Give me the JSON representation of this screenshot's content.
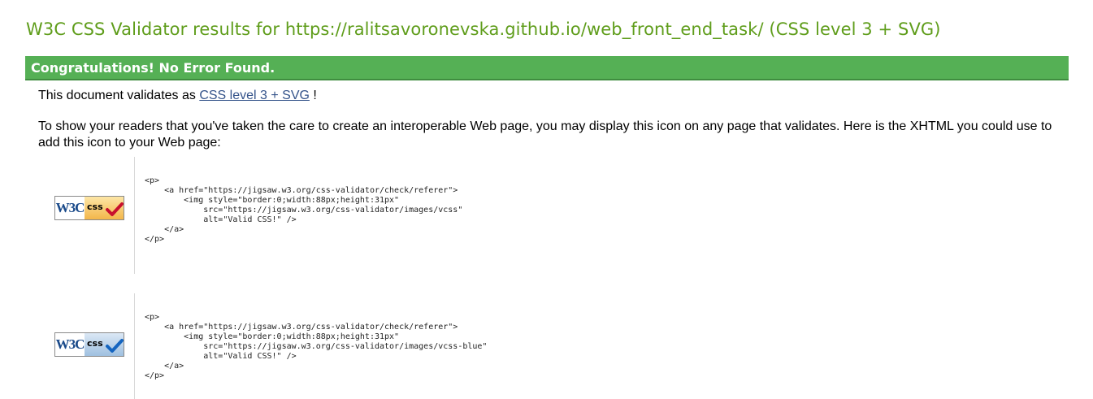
{
  "page": {
    "title": "W3C CSS Validator results for https://ralitsavoronevska.github.io/web_front_end_task/ (CSS level 3 + SVG)",
    "banner": "Congratulations! No Error Found.",
    "validates_prefix": "This document validates as",
    "validates_link": "CSS level 3 + SVG",
    "validates_suffix": "!",
    "description": "To show your readers that you've taken the care to create an interoperable Web page, you may display this icon on any page that validates. Here is the XHTML you could use to add this icon to your Web page:"
  },
  "badges": [
    {
      "w3c_text": "W3C",
      "css_text": "css",
      "variant": "gold",
      "check_color": "#c8102e",
      "code": "<p>\n    <a href=\"https://jigsaw.w3.org/css-validator/check/referer\">\n        <img style=\"border:0;width:88px;height:31px\"\n            src=\"https://jigsaw.w3.org/css-validator/images/vcss\"\n            alt=\"Valid CSS!\" />\n    </a>\n</p>"
    },
    {
      "w3c_text": "W3C",
      "css_text": "css",
      "variant": "blue",
      "check_color": "#1565c0",
      "code": "<p>\n    <a href=\"https://jigsaw.w3.org/css-validator/check/referer\">\n        <img style=\"border:0;width:88px;height:31px\"\n            src=\"https://jigsaw.w3.org/css-validator/images/vcss-blue\"\n            alt=\"Valid CSS!\" />\n    </a>\n</p>"
    }
  ]
}
